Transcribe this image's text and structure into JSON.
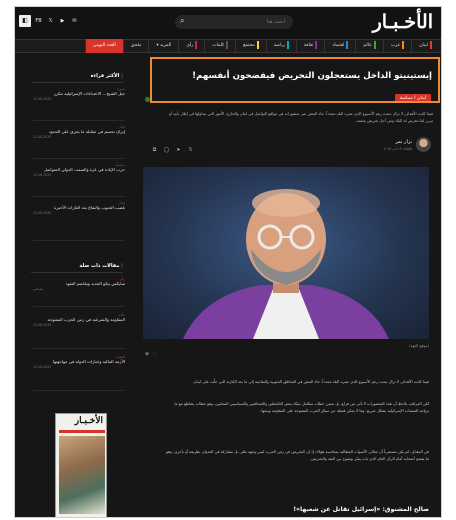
{
  "header": {
    "brand_main": "الأخـبـار",
    "social": [
      "FB",
      "𝕏",
      "▶",
      "✉"
    ],
    "search_placeholder": "ابحث هنا"
  },
  "nav": {
    "items": [
      "لبنان",
      "عرب",
      "عالم",
      "اقتصاد",
      "ثقافة",
      "رياضة",
      "مجتمع",
      "كلمات",
      "رأي",
      "ملحق",
      "العدد اليومي"
    ],
    "more_label": "المزيد ▾",
    "accent_colors": [
      "#e53935",
      "#fb8c00",
      "#43a047",
      "#1e88e5",
      "#8e24aa",
      "#00acc1",
      "#fdd835",
      "#6d4c41",
      "#d81b60"
    ]
  },
  "article": {
    "title": "إبستينيتو الداخل يستعجلون التحريض فيفضحون أنفسهم!",
    "category": "لبنان / سياسة",
    "summary": "فيما كانت الأهداف لا تزال تبحث رغم الأسبوع الذي عمره البلد مجدداً، جاء البعض عبر منشورات في مواقع التواصل في لبنان والخارج، الأمور التي يتداولها في إطار تأييد أو تبرير لما تتعرض له البلاد ومن أجل تحريض متعمد.",
    "author_name": "نزار نمر",
    "author_date": "الثلاثاء ١٢ آب ٢٠٢٥",
    "photo_caption": "(موقع العهد)",
    "paragraphs": [
      "فيما كانت الأهداف لا تزال تبحث رغم الأسبوع الذي عمره البلد مجدداً، جاء البعض في المناطق الجنوبية والبقاعية إلى ما بعد الكارثة التي حلّت على لبنان.",
      "لكن المراقب يلاحظ أن هذه المنشورات لا تأتي من فراغ، بل ضمن خطاب متكامل يتبنّاه بعض الناشطين والصحافيين والسياسيين المحليين، وهو خطاب يتقاطع مع ما تروّجه المنصات الإسرائيلية بشكل صريح، وما لا يمكن فصله عن سياق الحرب المفتوحة على المقاومة وبيئتها.",
      "في المقابل، لم يكن مستغرباً أن تتعالى الأصوات المطالبة بمحاسبة هؤلاء، إذ إن التحريض في زمن الحرب ليس وجهة نظر، بل مشاركة في العدوان بطريقة أو بأخرى، وهو ما يفضح أصحابه أمام الرأي العام الذي بات يميّز بوضوح بين النقد والتحريض."
    ],
    "subheading": "صالح المشنوق: «إسرائيل تقاتل عن شعبها»!"
  },
  "sidebar": {
    "latest_title": "الأكثر قراءة",
    "latest": [
      {
        "cat": "سوريا",
        "text": "جبل الشيخ... الاعتداءات الإسرائيلية تتكرر",
        "time": "12.08.2025"
      },
      {
        "cat": "لبنان",
        "text": "إيران تحسم في مقابلة ما يجري على الحدود",
        "time": "12.08.2025"
      },
      {
        "cat": "سياسة",
        "text": "حرب الإبادة في غزة والصمت الدولي المتواصل",
        "time": "12.08.2025"
      },
      {
        "cat": "لبنان",
        "text": "غضب الجنوب والبقاع بعد الغارات الأخيرة",
        "time": "12.08.2025"
      }
    ],
    "opinion_title": "مقالات ذات صلة",
    "opinion": [
      {
        "cat": "رأي",
        "text": "سايكس بيكو الجديد وتقاسم النفوذ",
        "time": "سايكس"
      },
      {
        "cat": "عالم",
        "text": "المقاومة والشرعية في زمن الحرب المفتوحة",
        "time": "12.08.2025"
      },
      {
        "cat": "اقتصاد",
        "text": "الأزمة المالية وخيارات الدولة في مواجهتها",
        "time": "12.08.2025"
      }
    ],
    "cover_brand": "الأخـبـار"
  }
}
